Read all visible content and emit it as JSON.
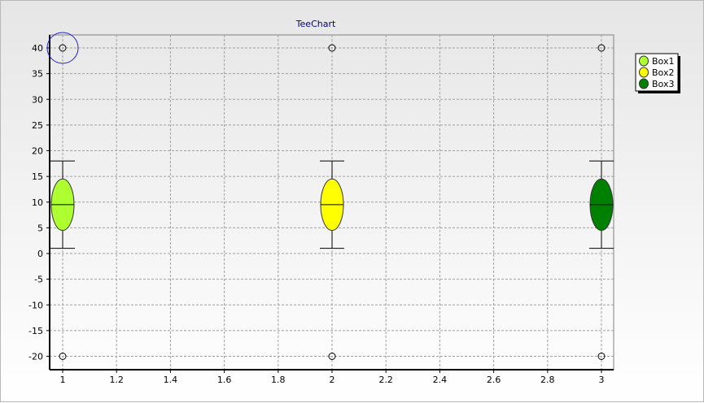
{
  "chart_data": {
    "type": "box",
    "title": "TeeChart",
    "xlim": [
      1,
      3
    ],
    "ylim": [
      -22,
      43
    ],
    "x_ticks": [
      "1",
      "1.2",
      "1.4",
      "1.6",
      "1.8",
      "2",
      "2.2",
      "2.4",
      "2.6",
      "2.8",
      "3"
    ],
    "y_ticks": [
      "40",
      "35",
      "30",
      "25",
      "20",
      "15",
      "10",
      "5",
      "0",
      "-5",
      "-10",
      "-15",
      "-20"
    ],
    "grid": true,
    "legend_position": "top-right",
    "series": [
      {
        "name": "Box1",
        "x": 1,
        "whisker_low": 1,
        "q1": 4.5,
        "median": 9.5,
        "q3": 14.5,
        "whisker_high": 18,
        "outliers": [
          40,
          -20
        ],
        "color": "#adff2f"
      },
      {
        "name": "Box2",
        "x": 2,
        "whisker_low": 1,
        "q1": 4.5,
        "median": 9.5,
        "q3": 14.5,
        "whisker_high": 18,
        "outliers": [
          40,
          -20
        ],
        "color": "#ffff00"
      },
      {
        "name": "Box3",
        "x": 3,
        "whisker_low": 1,
        "q1": 4.5,
        "median": 9.5,
        "q3": 14.5,
        "whisker_high": 18,
        "outliers": [
          40,
          -20
        ],
        "color": "#008000"
      }
    ],
    "highlight": {
      "series": "Box1",
      "value": 40,
      "color": "#2222cc"
    }
  }
}
